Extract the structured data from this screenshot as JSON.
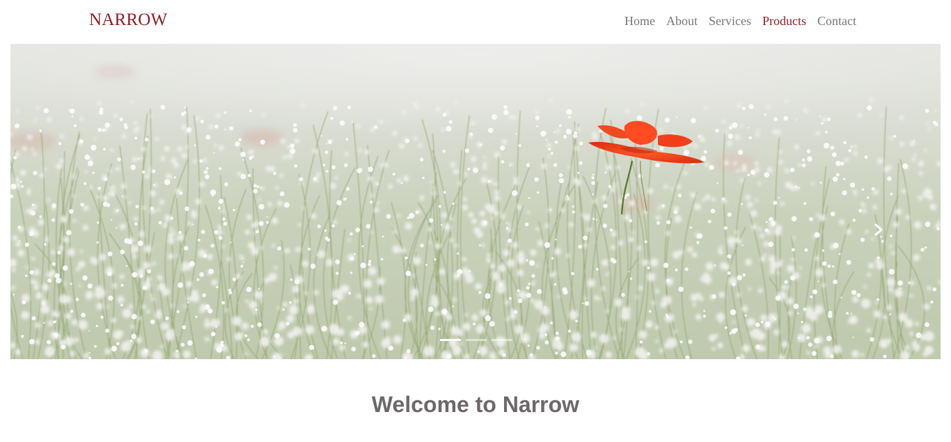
{
  "navbar": {
    "brand": "NARROW",
    "items": [
      {
        "label": "Home",
        "active": false
      },
      {
        "label": "About",
        "active": false
      },
      {
        "label": "Services",
        "active": false
      },
      {
        "label": "Products",
        "active": true
      },
      {
        "label": "Contact",
        "active": false
      }
    ]
  },
  "carousel": {
    "indicators": [
      {
        "active": true
      },
      {
        "active": false
      },
      {
        "active": false
      }
    ]
  },
  "main": {
    "heading": "Welcome to Narrow",
    "lead": ""
  },
  "colors": {
    "brand": "#8b1f26",
    "nav_text": "#777777",
    "heading": "#6e6869"
  }
}
